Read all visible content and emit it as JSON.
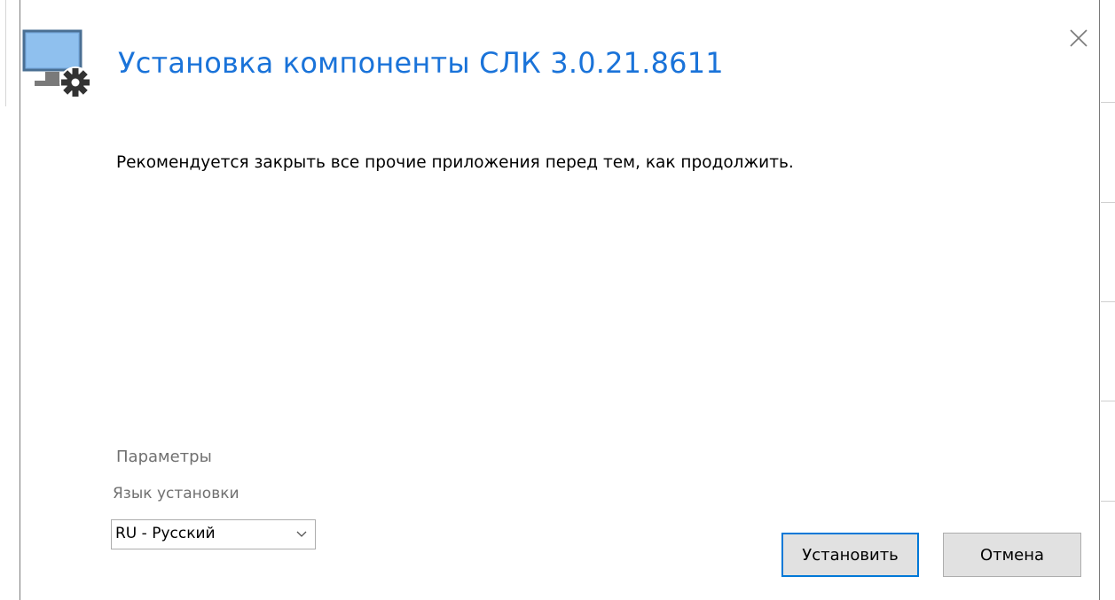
{
  "dialog": {
    "title": "Установка компоненты СЛК 3.0.21.8611",
    "message": "Рекомендуется закрыть все прочие приложения перед тем, как продолжить.",
    "params_title": "Параметры",
    "language_label": "Язык установки",
    "language_value": "RU - Русский",
    "install_button": "Установить",
    "cancel_button": "Отмена",
    "close_icon": "close-icon",
    "app_icon": "monitor-gear-icon"
  },
  "colors": {
    "title": "#1a73d9",
    "accent_border": "#0078d7",
    "button_bg": "#e1e1e1",
    "label_gray": "#707070"
  }
}
